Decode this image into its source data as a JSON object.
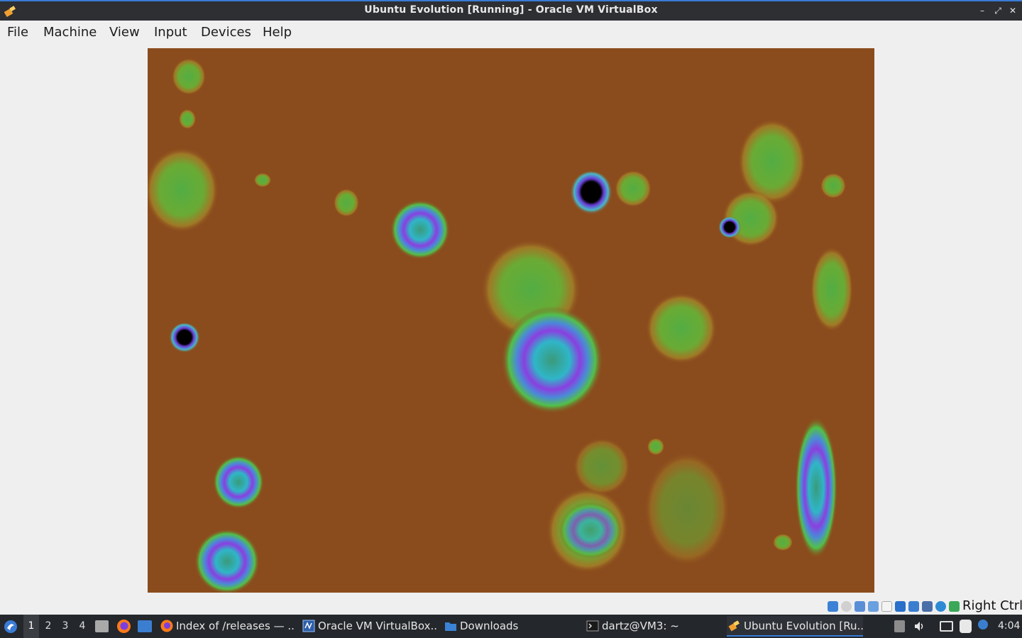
{
  "window": {
    "title": "Ubuntu Evolution [Running] - Oracle VM VirtualBox",
    "controls": {
      "minimize": "–",
      "restore": "⤢",
      "close": "✕"
    }
  },
  "menu": {
    "items": [
      "File",
      "Machine",
      "View",
      "Input",
      "Devices",
      "Help"
    ]
  },
  "vm": {
    "background_color": "#8b4c1d",
    "content": "abstract bubbles screensaver"
  },
  "statusbar": {
    "icons": [
      "hard-disk-icon",
      "optical-drive-icon",
      "audio-icon",
      "network-icon",
      "usb-icon",
      "shared-folders-icon",
      "display-icon",
      "video-capture-icon",
      "cpu-icon",
      "mouse-integration-icon",
      "keyboard-icon"
    ],
    "host_key": "Right Ctrl"
  },
  "taskbar": {
    "workspaces": [
      "1",
      "2",
      "3",
      "4"
    ],
    "active_workspace": "1",
    "tasks": [
      {
        "label": "Index of /releases — ...",
        "icon": "firefox-icon"
      },
      {
        "label": "Oracle VM VirtualBox...",
        "icon": "virtualbox-icon"
      },
      {
        "label": "Downloads",
        "icon": "folder-icon"
      },
      {
        "label": "dartz@VM3: ~",
        "icon": "terminal-icon"
      },
      {
        "label": "Ubuntu Evolution [Ru...",
        "icon": "virtualbox-vm-icon"
      }
    ],
    "clock": "4:04",
    "accent": "#3a7bd5"
  }
}
